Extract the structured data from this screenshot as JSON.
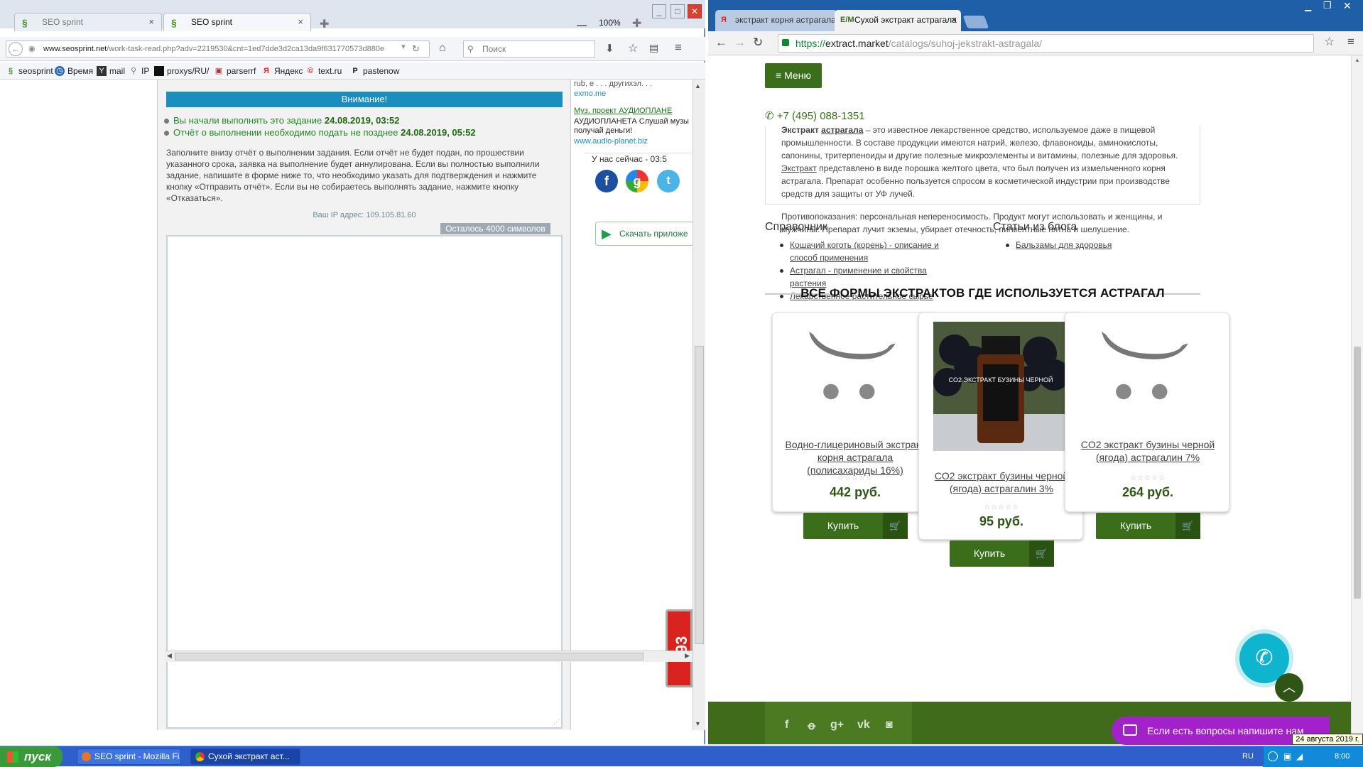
{
  "firefox": {
    "tabs": [
      {
        "label": "SEO sprint",
        "active": false
      },
      {
        "label": "SEO sprint",
        "active": true
      }
    ],
    "zoom": "100%",
    "url_host": "www.seosprint.net",
    "url_path": "/work-task-read.php?adv=2219530&cnt=1ed7dde3d2ca13da9f631770573d880e",
    "search_placeholder": "Поиск",
    "bookmarks": [
      {
        "label": "seosprint",
        "icon": "seosprint-icon"
      },
      {
        "label": "Время",
        "icon": "clock-icon"
      },
      {
        "label": "mail",
        "icon": "yahoo-icon"
      },
      {
        "label": "IP",
        "icon": "magnifier-icon"
      },
      {
        "label": "proxys/RU/",
        "icon": "black-square-icon"
      },
      {
        "label": "parserrf",
        "icon": "parser-icon"
      },
      {
        "label": "Яндекс",
        "icon": "yandex-icon"
      },
      {
        "label": "text.ru",
        "icon": "copyright-icon"
      },
      {
        "label": "pastenow",
        "icon": "p-icon"
      }
    ],
    "task": {
      "attention": "Внимание!",
      "started_label": "Вы начали выполнять это задание",
      "started_time": "24.08.2019, 03:52",
      "deadline_label": "Отчёт о выполнении необходимо подать не позднее",
      "deadline_time": "24.08.2019, 05:52",
      "instructions": "Заполните внизу отчёт о выполнении задания. Если отчёт не будет подан, по прошествии указанного срока, заявка на выполнение будет аннулирована. Если вы полностью выполнили задание, напишите в форме ниже то, что необходимо указать для подтверждения и нажмите кнопку «Отправить отчёт». Если вы не собираетесь выполнять задание, нажмите кнопку «Отказаться».",
      "ip_text": "Ваш IP адрес: 109.105.81.60",
      "remaining": "Осталось 4000 символов"
    },
    "sidebar": {
      "ad1_text": "rub, e . . . другихэл. . .",
      "ad1_link": "exmo.me",
      "ad2_title": "Муз. проект АУДИОПЛАНЕ",
      "ad2_text": "АУДИОПЛАНЕТА Слушай музы получай деньги!",
      "ad2_link": "www.audio-planet.biz",
      "now_label": "У нас сейчас - 03:5",
      "download": "Скачать приложе"
    },
    "badge": "393"
  },
  "chrome": {
    "tabs": [
      {
        "label": "экстракт корня астрагала",
        "icon": "yandex-icon",
        "active": false
      },
      {
        "label": "Сухой экстракт астрагала",
        "icon": "em-icon",
        "active": true
      }
    ],
    "url_scheme": "https://",
    "url_host": "extract.market",
    "url_path": "/catalogs/suhoj-jekstrakt-astragala/",
    "page": {
      "menu_label": "Меню",
      "phone": "+7 (495) 088-1351",
      "desc_intro_bold": "Экстракт",
      "desc_intro_link": "астрагала",
      "desc_intro_rest": " – это известное лекарственное средство, используемое даже в пищевой промышленности. В составе продукции имеются натрий, железо, флавоноиды, аминокислоты, сапонины, тритерпеноиды и другие полезные микроэлементы и витамины, полезные для здоровья.",
      "desc_extract_link": "Экстракт",
      "desc_extract_rest": " представлено в виде порошка желтого цвета, что был получен из измельченного корня астрагала. Препарат особенно пользуется спросом в косметической индустрии при производстве средств для защиты от УФ лучей.",
      "contra": "Противопоказания: персональная непереносимость. Продукт могут использовать и женщины, и мужчины. Препарат лучит экземы, убирает отечность, пигментные пятна и шелушение.",
      "reference_title": "Справочник",
      "reference_items": [
        "Кошачий коготь (корень) - описание и способ применения",
        "Астрагал - применение и свойства растения",
        "Лекарственное растительное сырье"
      ],
      "blog_title": "Статьи из блога",
      "blog_items": [
        "Бальзамы для здоровья"
      ],
      "forms_title": "ВСЕ ФОРМЫ ЭКСТРАКТОВ ГДЕ ИСПОЛЬЗУЕТСЯ АСТРАГАЛ",
      "products": [
        {
          "name": "Водно-глицериновый экстракт корня астрагала (полисахариды 16%)",
          "stars": "☆☆☆☆☆",
          "price": "442 руб.",
          "buy": "Купить",
          "image": "placeholder-cart-icon"
        },
        {
          "name": "CO2 экстракт бузины черной (ягода) астрагалин 3%",
          "stars": "☆☆☆☆☆",
          "price": "95 руб.",
          "buy": "Купить",
          "image": "elderberry-bottle-photo",
          "bottle_label": "CO2 ЭКСТРАКТ БУЗИНЫ ЧЕРНОЙ"
        },
        {
          "name": "CO2 экстракт бузины черной (ягода) астрагалин 7%",
          "stars": "☆☆☆☆☆",
          "price": "264 руб.",
          "buy": "Купить",
          "image": "placeholder-cart-icon"
        }
      ],
      "chat_text": "Если есть вопросы напишите нам"
    }
  },
  "taskbar": {
    "start": "пуск",
    "tasks": [
      {
        "label": "SEO sprint - Mozilla Fi...",
        "icon": "firefox-icon"
      },
      {
        "label": "Сухой экстракт аст...",
        "icon": "chrome-icon"
      }
    ],
    "lang": "RU",
    "clock": "8:00",
    "date_tooltip": "24 августа 2019 г."
  },
  "colors": {
    "brand_green": "#3a6e1a",
    "attention_blue": "#1a8fbf",
    "chat_purple": "#a321c8",
    "call_cyan": "#0fb4cf"
  }
}
